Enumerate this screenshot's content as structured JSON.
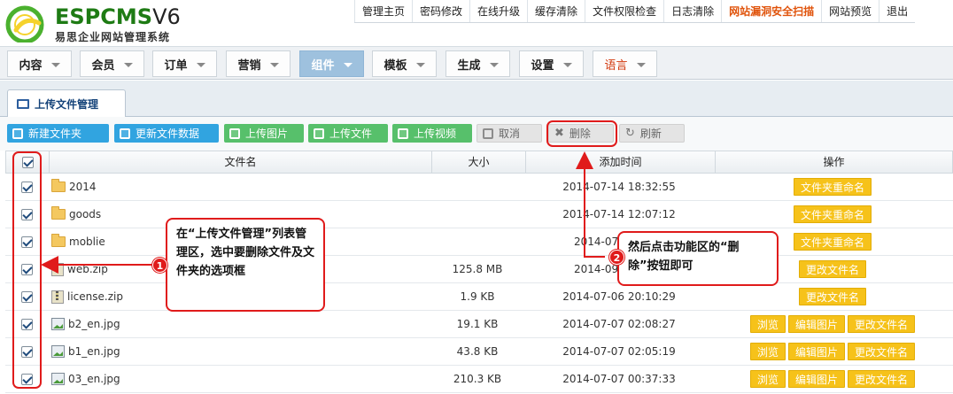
{
  "brand": {
    "name": "ESPCMS",
    "version": "V6",
    "subtitle": "易思企业网站管理系统"
  },
  "topnav": [
    {
      "label": "管理主页"
    },
    {
      "label": "密码修改"
    },
    {
      "label": "在线升级"
    },
    {
      "label": "缓存清除"
    },
    {
      "label": "文件权限检查"
    },
    {
      "label": "日志清除"
    },
    {
      "label": "网站漏洞安全扫描"
    },
    {
      "label": "网站预览"
    },
    {
      "label": "退出"
    }
  ],
  "mainmenu": [
    {
      "label": "内容"
    },
    {
      "label": "会员"
    },
    {
      "label": "订单"
    },
    {
      "label": "营销"
    },
    {
      "label": "组件"
    },
    {
      "label": "模板"
    },
    {
      "label": "生成"
    },
    {
      "label": "设置"
    },
    {
      "label": "语言"
    }
  ],
  "active_menu": "组件",
  "panel_tab": "上传文件管理",
  "toolbar": {
    "new_folder": "新建文件夹",
    "update_data": "更新文件数据",
    "upload_image": "上传图片",
    "upload_file": "上传文件",
    "upload_video": "上传视频",
    "cancel": "取消",
    "delete": "删除",
    "refresh": "刷新"
  },
  "table": {
    "headers": {
      "name": "文件名",
      "size": "大小",
      "time": "添加时间",
      "ops": "操作"
    },
    "rows": [
      {
        "type": "folder",
        "name": "2014",
        "size": "",
        "time": "2014-07-14 18:32:55",
        "ops": [
          "文件夹重命名"
        ]
      },
      {
        "type": "folder",
        "name": "goods",
        "size": "",
        "time": "2014-07-14 12:07:12",
        "ops": [
          "文件夹重命名"
        ]
      },
      {
        "type": "folder",
        "name": "moblie",
        "size": "",
        "time": "2014-07-1",
        "ops": [
          "文件夹重命名"
        ]
      },
      {
        "type": "zip",
        "name": "web.zip",
        "size": "125.8 MB",
        "time": "2014-09-1",
        "ops": [
          "更改文件名"
        ]
      },
      {
        "type": "zip",
        "name": "license.zip",
        "size": "1.9 KB",
        "time": "2014-07-06 20:10:29",
        "ops": [
          "更改文件名"
        ]
      },
      {
        "type": "image",
        "name": "b2_en.jpg",
        "size": "19.1 KB",
        "time": "2014-07-07 02:08:27",
        "ops": [
          "浏览",
          "编辑图片",
          "更改文件名"
        ]
      },
      {
        "type": "image",
        "name": "b1_en.jpg",
        "size": "43.8 KB",
        "time": "2014-07-07 02:05:19",
        "ops": [
          "浏览",
          "编辑图片",
          "更改文件名"
        ]
      },
      {
        "type": "image",
        "name": "03_en.jpg",
        "size": "210.3 KB",
        "time": "2014-07-07 00:37:33",
        "ops": [
          "浏览",
          "编辑图片",
          "更改文件名"
        ]
      }
    ]
  },
  "annotations": {
    "step1": {
      "num": "1",
      "text": "在“上传文件管理”列表管理区，选中要删除文件及文件夹的选项框"
    },
    "step2": {
      "num": "2",
      "text": "然后点击功能区的“删除”按钮即可"
    }
  },
  "colors": {
    "accent": "#e01b1b",
    "menu_active": "#9ec1de",
    "op_button": "#f6c21a",
    "brand_green": "#1e7b14"
  },
  "icons": {
    "toolbar": [
      "edit-icon",
      "database-icon",
      "image-upload-icon",
      "file-upload-icon",
      "video-upload-icon",
      "checkbox-icon",
      "close-icon",
      "refresh-icon"
    ],
    "rows": {
      "folder": "folder-icon",
      "zip": "zip-file-icon",
      "image": "image-file-icon"
    }
  }
}
